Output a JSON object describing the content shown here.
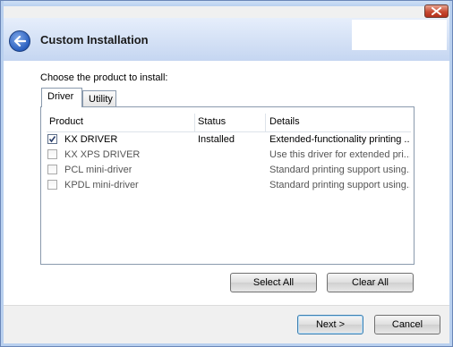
{
  "window": {
    "title": "Custom Installation",
    "close_label": "Close"
  },
  "main": {
    "prompt": "Choose the product to install:",
    "tabs": [
      {
        "label": "Driver",
        "active": true
      },
      {
        "label": "Utility",
        "active": false
      }
    ],
    "columns": {
      "product": "Product",
      "status": "Status",
      "details": "Details"
    },
    "rows": [
      {
        "product": "KX DRIVER",
        "status": "Installed",
        "details": "Extended-functionality printing ...",
        "checked": true
      },
      {
        "product": "KX XPS DRIVER",
        "status": "",
        "details": "Use this driver for extended pri...",
        "checked": false
      },
      {
        "product": "PCL mini-driver",
        "status": "",
        "details": "Standard printing support using...",
        "checked": false
      },
      {
        "product": "KPDL mini-driver",
        "status": "",
        "details": "Standard printing support using...",
        "checked": false
      }
    ],
    "select_all_label": "Select All",
    "clear_all_label": "Clear All"
  },
  "footer": {
    "next_label": "Next >",
    "cancel_label": "Cancel"
  },
  "colors": {
    "header_gradient_top": "#e6eefb",
    "header_gradient_bottom": "#c5d6f1",
    "close_button": "#c84a33",
    "back_button": "#2a5fbf"
  }
}
